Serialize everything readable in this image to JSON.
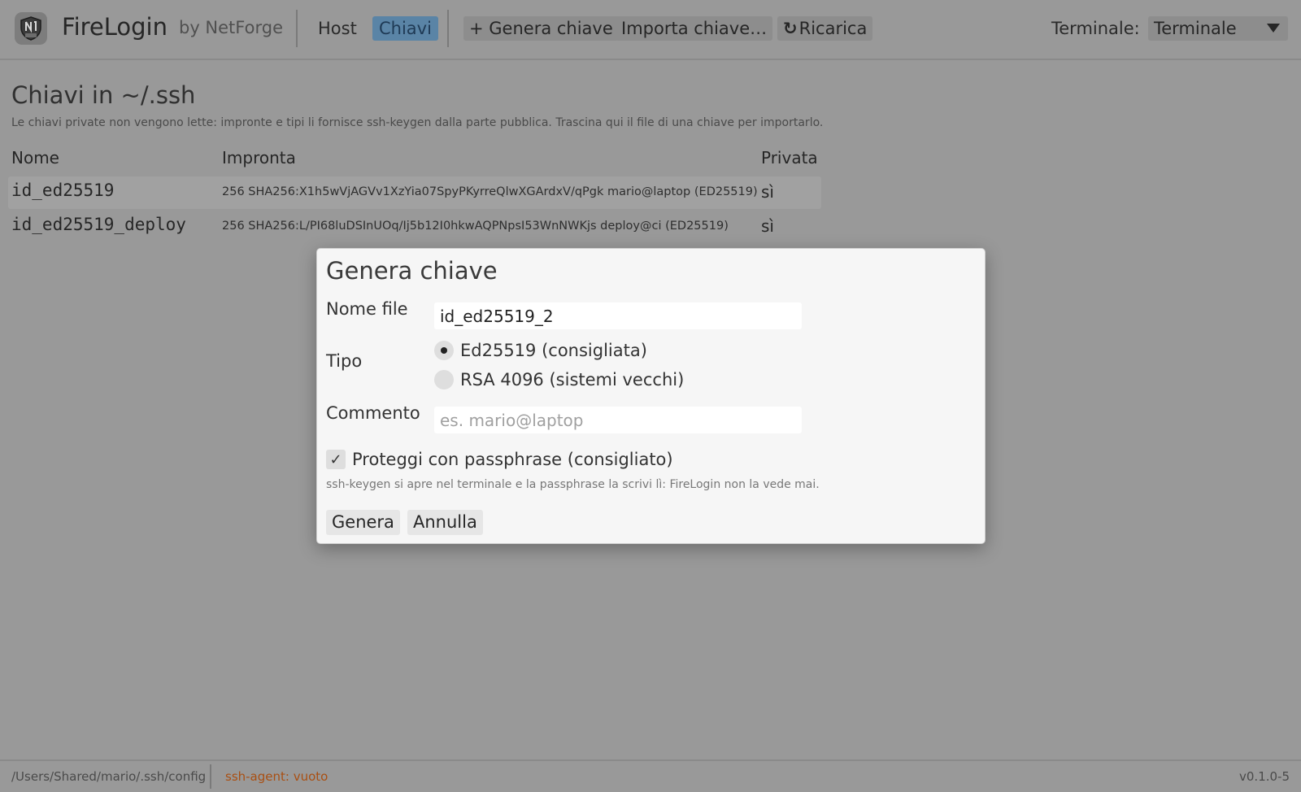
{
  "app": {
    "brand": "FireLogin",
    "by": "by NetForge",
    "logo_icon": "shield-logo-icon"
  },
  "toolbar": {
    "tabs": [
      {
        "label": "Host",
        "active": false
      },
      {
        "label": "Chiavi",
        "active": true
      }
    ],
    "generate_label": "+ Genera chiave",
    "import_label": "Importa chiave…",
    "reload_label": "Ricarica",
    "reload_icon": "reload-icon",
    "terminal_label": "Terminale:",
    "terminal_value": "Terminale"
  },
  "main": {
    "heading": "Chiavi in ~/.ssh",
    "hint": "Le chiavi private non vengono lette: impronte e tipi li fornisce ssh-keygen dalla parte pubblica. Trascina qui il file di una chiave per importarlo.",
    "columns": {
      "name": "Nome",
      "fingerprint": "Impronta",
      "private": "Privata"
    },
    "keys": [
      {
        "name": "id_ed25519",
        "fingerprint": "256 SHA256:X1h5wVjAGVv1XzYia07SpyPKyrreQlwXGArdxV/qPgk mario@laptop (ED25519)",
        "private": "sì"
      },
      {
        "name": "id_ed25519_deploy",
        "fingerprint": "256 SHA256:L/PI68luDSInUOq/Ij5b12I0hkwAQPNpsI53WnNWKjs deploy@ci (ED25519)",
        "private": "sì"
      }
    ]
  },
  "modal": {
    "title": "Genera chiave",
    "filename_label": "Nome file",
    "filename_value": "id_ed25519_2",
    "type_label": "Tipo",
    "type_options": [
      {
        "label": "Ed25519 (consigliata)",
        "checked": true
      },
      {
        "label": "RSA 4096 (sistemi vecchi)",
        "checked": false
      }
    ],
    "comment_label": "Commento",
    "comment_placeholder": "es. mario@laptop",
    "comment_value": "",
    "passphrase_label": "Proteggi con passphrase (consigliato)",
    "passphrase_checked": true,
    "note": "ssh-keygen si apre nel terminale e la passphrase la scrivi lì: FireLogin non la vede mai.",
    "generate_label": "Genera",
    "cancel_label": "Annulla"
  },
  "status": {
    "path": "/Users/Shared/mario/.ssh/config",
    "agent": "ssh-agent: vuoto",
    "version": "v0.1.0-5"
  },
  "colors": {
    "active_tab": "#5a84a6",
    "agent_warning": "#a94f12",
    "backdrop": "#999999",
    "modal_bg": "#f6f6f6"
  }
}
